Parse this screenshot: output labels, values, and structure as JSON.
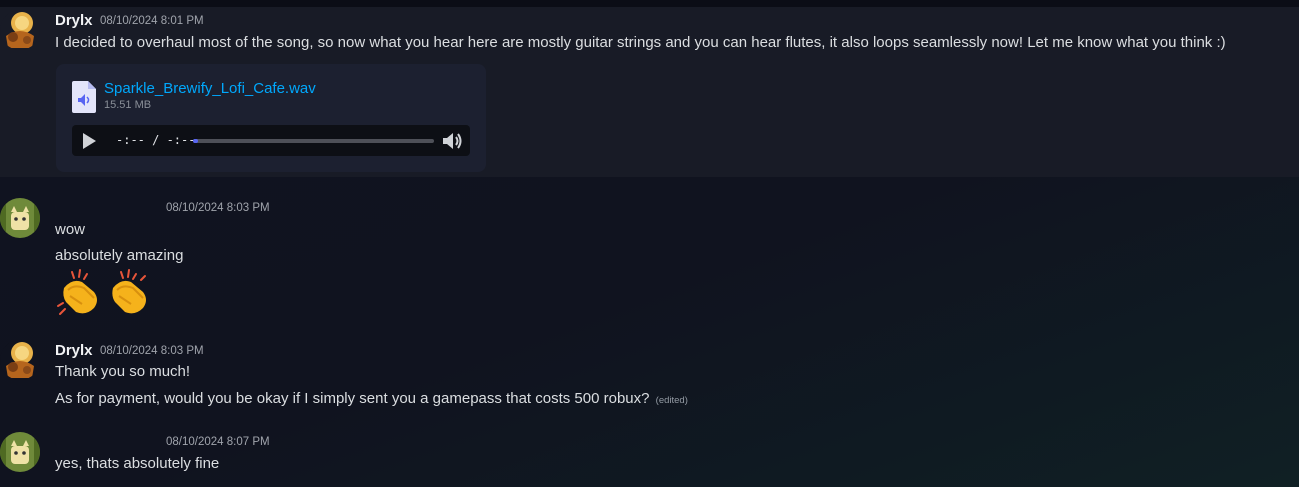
{
  "messages": [
    {
      "author": "Drylx",
      "timestamp": "08/10/2024 8:01 PM",
      "lines": [
        "I decided to overhaul most of the song, so now what you hear here are mostly guitar strings and you can hear flutes, it also loops seamlessly now! Let me know what you think :)"
      ],
      "attachment": {
        "filename": "Sparkle_Brewify_Lofi_Cafe.wav",
        "size": "15.51 MB",
        "time_display": "-:-- / -:--",
        "progress": 0.02
      }
    },
    {
      "author": "",
      "timestamp": "08/10/2024 8:03 PM",
      "lines": [
        "wow",
        "absolutely amazing"
      ],
      "emojis": [
        "clapping-hands-emoji",
        "clapping-hands-emoji"
      ]
    },
    {
      "author": "Drylx",
      "timestamp": "08/10/2024 8:03 PM",
      "lines": [
        "Thank you so much!",
        "As for payment, would you be okay if I simply sent you a gamepass that costs 500 robux?"
      ],
      "edited_label": "(edited)"
    },
    {
      "author": "",
      "timestamp": "08/10/2024 8:07 PM",
      "lines": [
        "yes, thats absolutely fine"
      ]
    }
  ],
  "colors": {
    "link": "#00a8fc",
    "accent": "#5865f2",
    "highlight": "#181b26"
  }
}
